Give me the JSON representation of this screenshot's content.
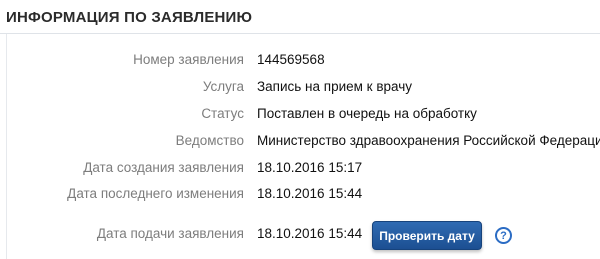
{
  "section_title": "ИНФОРМАЦИЯ ПО ЗАЯВЛЕНИЮ",
  "fields": [
    {
      "label": "Номер заявления",
      "value": "144569568"
    },
    {
      "label": "Услуга",
      "value": "Запись на прием к врачу"
    },
    {
      "label": "Статус",
      "value": "Поставлен в очередь на обработку"
    },
    {
      "label": "Ведомство",
      "value": "Министерство здравоохранения Российской Федерации"
    },
    {
      "label": "Дата создания заявления",
      "value": "18.10.2016 15:17"
    },
    {
      "label": "Дата последнего изменения",
      "value": "18.10.2016 15:44"
    },
    {
      "label": "Дата подачи заявления",
      "value": "18.10.2016 15:44"
    }
  ],
  "check_button_label": "Проверить дату",
  "help_icon_glyph": "?",
  "colors": {
    "button": "#1f5aa6",
    "help": "#2b6cc4",
    "label": "#7d7d7d"
  }
}
